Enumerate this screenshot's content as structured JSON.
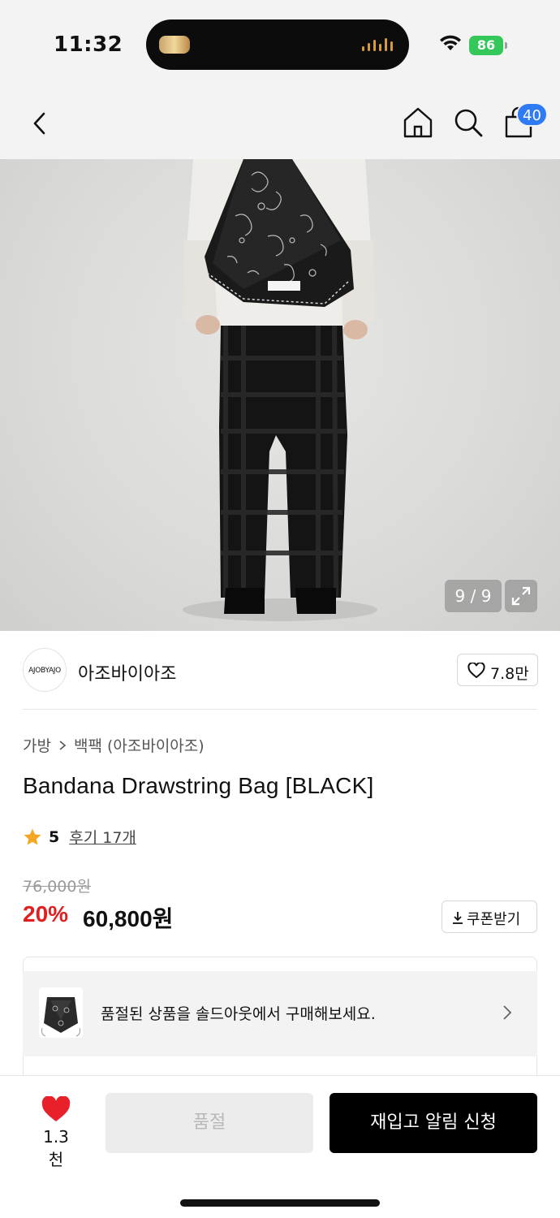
{
  "status_bar": {
    "time": "11:32",
    "battery": "86",
    "battery_color": "#34c759"
  },
  "nav": {
    "back_icon": "chevron-left-icon",
    "home_icon": "home-icon",
    "search_icon": "search-icon",
    "cart_icon": "shopping-bag-icon",
    "cart_count": "40",
    "badge_color": "#2f7bf5"
  },
  "gallery": {
    "counter": "9 / 9",
    "expand_icon": "expand-icon"
  },
  "brand": {
    "logo_text": "AJOBYAJO",
    "name": "아조바이아조",
    "like_count": "7.8만"
  },
  "product": {
    "breadcrumb": [
      "가방",
      "백팩 (아조바이아조)"
    ],
    "title": "Bandana Drawstring Bag [BLACK]",
    "rating": "5",
    "reviews": "후기 17개",
    "original_price": "76,000원",
    "discount": "20%",
    "price": "60,800원",
    "coupon_label": "쿠폰받기",
    "discount_color": "#e02020"
  },
  "soldout_banner": {
    "text": "품절된 상품을 솔드아웃에서 구매해보세요."
  },
  "bottom": {
    "wish_count": "1.3천",
    "soldout_label": "품절",
    "restock_label": "재입고 알림 신청",
    "heart_color": "#e8202a"
  }
}
